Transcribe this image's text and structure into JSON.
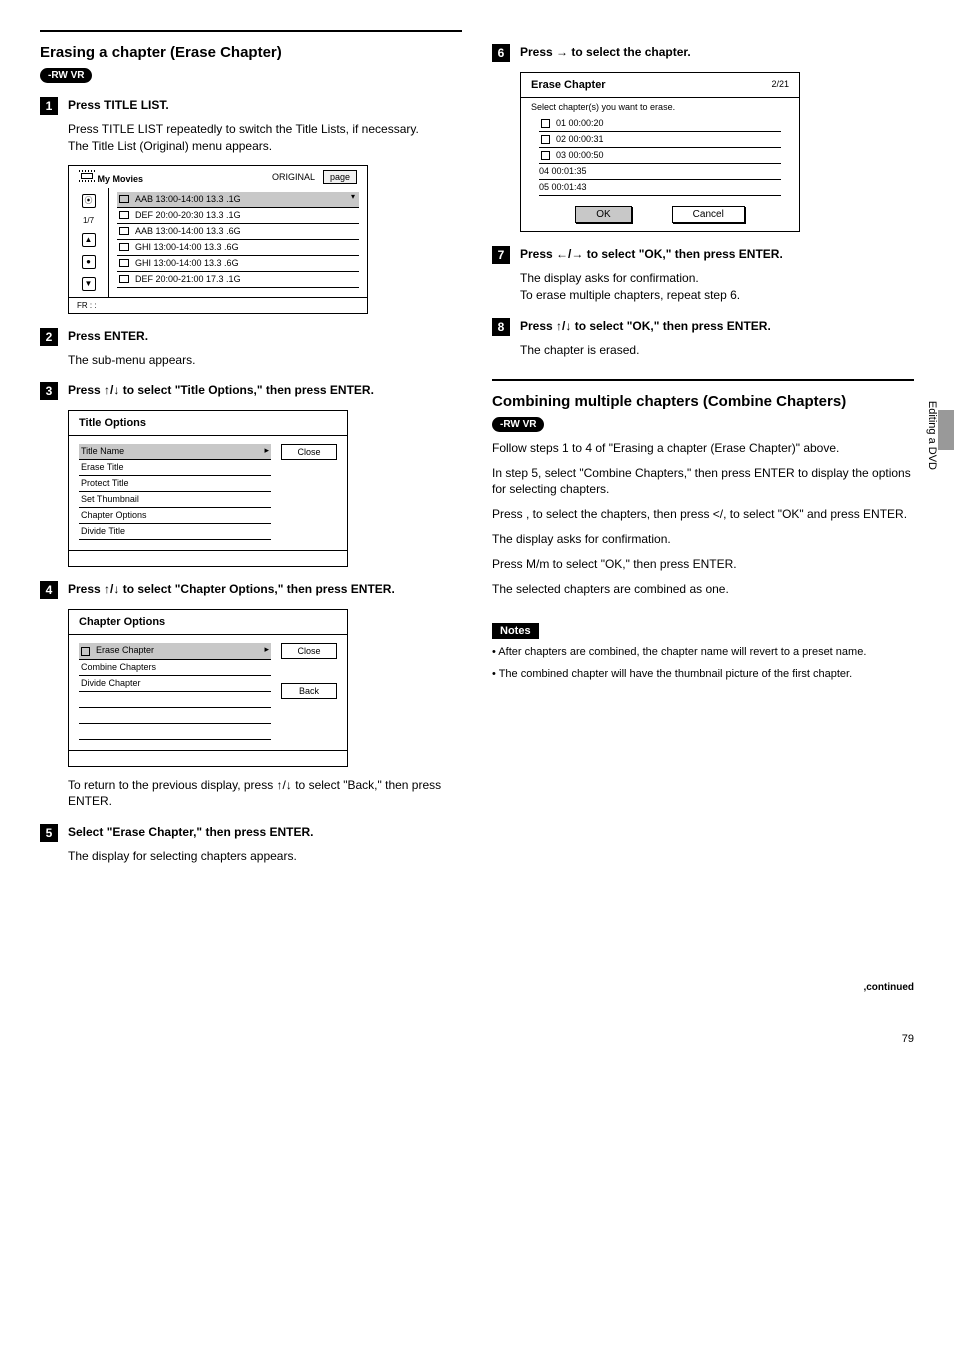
{
  "side_label": "Editing a DVD",
  "page_number": "79",
  "left": {
    "heading1": "Erasing a chapter (Erase Chapter)",
    "step1": "Press TITLE LIST.",
    "step1_sub1": "Press TITLE LIST repeatedly to switch the Title Lists, if necessary.",
    "step1_sub2": "The Title List (Original) menu appears.",
    "shot1": {
      "header": "My Movies",
      "original": "ORIGINAL",
      "count": "1/7",
      "page": "page",
      "rows": [
        "AAB  13:00-14:00          13.3  .1G",
        "DEF  20:00-20:30          13.3  .1G",
        "AAB  13:00-14:00          13.3  .6G",
        "GHI  13:00-14:00          13.3  .6G",
        "GHI  13:00-14:00          13.3  .6G",
        "DEF  20:00-21:00          17.3  .1G"
      ],
      "footer": "FR   :   :"
    },
    "step2": "Press ENTER.",
    "step2_sub": "The sub-menu appears.",
    "step3_pre": "Press ",
    "step3_mid": "M/m",
    "step3_post": " to select \"Title Options,\" then press ENTER.",
    "shot2": {
      "header": "Title Options",
      "rows": [
        "Title Name",
        "Erase Title",
        "Protect Title",
        "Set Thumbnail",
        "Chapter Options",
        "Divide Title"
      ],
      "btn": "Close"
    },
    "step4_pre": "Press ",
    "step4_mid": "M/m",
    "step4_post": " to select \"Chapter Options,\" then press ENTER.",
    "shot3": {
      "header": "Chapter Options",
      "rows": [
        "Erase Chapter",
        "Combine Chapters",
        "Divide Chapter",
        "",
        "",
        ""
      ],
      "btn1": "Close",
      "btn2": "Back"
    },
    "step4_extra_pre": "To return to the previous display, press ",
    "step4_extra_mid": "M/m",
    "step4_extra_post": " to select \"Back,\" then press ENTER.",
    "step5_a": "Select \"Erase Chapter,\" then press ENTER.",
    "step5_b": "The display for selecting chapters appears."
  },
  "right": {
    "step6_pre": "Press ",
    "step6_mid": ",",
    "step6_post": " to select the chapter.",
    "shot4": {
      "header": "Erase Chapter",
      "count": "2/21",
      "sub": "Select chapter(s) you want to erase.",
      "rows": [
        "01  00:00:20",
        "02  00:00:31",
        "03  00:00:50",
        "04  00:01:35",
        "05  00:01:43"
      ],
      "ok": "OK",
      "cancel": "Cancel"
    },
    "step7_pre": "Press ",
    "step7_mid": "</,",
    "step7_post": " to select \"OK,\" then press ENTER.",
    "step7_sub": "The display asks for confirmation.",
    "step7_extra": "To erase multiple chapters, repeat step 6.",
    "step8_pre": "Press ",
    "step8_mid": "M/m",
    "step8_post": " to select \"OK,\" then press ENTER.",
    "step8_sub": "The chapter is erased.",
    "heading2": "Combining multiple chapters (Combine Chapters)",
    "combine_steps_a": "Follow steps 1 to 4 of \"Erasing a chapter (Erase Chapter)\" above.",
    "combine_steps_b": "In step 5, select \"Combine Chapters,\" then press ENTER to display the options for selecting chapters.",
    "combine_steps_c": "Press , to select the chapters, then press </, to select \"OK\" and press ENTER.",
    "combine_steps_d": "The display asks for confirmation.",
    "combine_steps_e": "Press M/m to select \"OK,\" then press ENTER.",
    "combine_steps_f": "The selected chapters are combined as one.",
    "notes_label": "Notes",
    "note1": "• After chapters are combined, the chapter name will revert to a preset name.",
    "note2": "• The combined chapter will have the thumbnail picture of the first chapter.",
    "continued": ",continued"
  }
}
